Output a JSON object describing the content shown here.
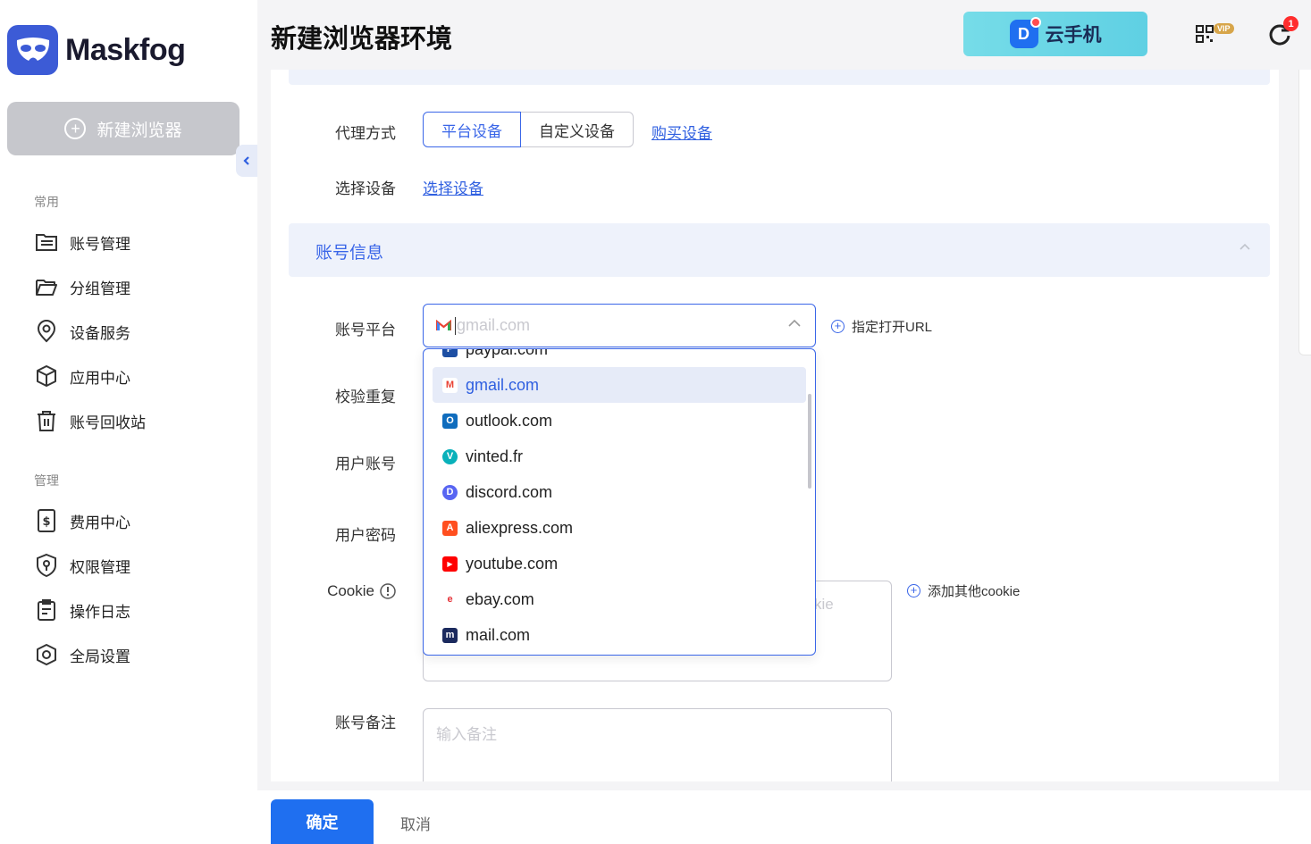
{
  "app": {
    "name": "Maskfog"
  },
  "sidebar": {
    "new_browser_label": "新建浏览器",
    "sections": [
      {
        "title": "常用",
        "items": [
          {
            "label": "账号管理",
            "icon": "account-list-icon"
          },
          {
            "label": "分组管理",
            "icon": "folder-icon"
          },
          {
            "label": "设备服务",
            "icon": "location-pin-icon"
          },
          {
            "label": "应用中心",
            "icon": "cube-icon"
          },
          {
            "label": "账号回收站",
            "icon": "trash-icon"
          }
        ]
      },
      {
        "title": "管理",
        "items": [
          {
            "label": "费用中心",
            "icon": "billing-icon"
          },
          {
            "label": "权限管理",
            "icon": "shield-key-icon"
          },
          {
            "label": "操作日志",
            "icon": "clipboard-icon"
          },
          {
            "label": "全局设置",
            "icon": "settings-hex-icon"
          }
        ]
      }
    ]
  },
  "header": {
    "title": "新建浏览器环境",
    "cloud_phone_label": "云手机",
    "vip_label": "VIP",
    "sync_badge": "1"
  },
  "form": {
    "proxy_label": "代理方式",
    "proxy_options": [
      "平台设备",
      "自定义设备"
    ],
    "proxy_selected": "平台设备",
    "buy_device_link": "购买设备",
    "select_device_label": "选择设备",
    "select_device_link": "选择设备",
    "account_section_title": "账号信息",
    "platform_label": "账号平台",
    "platform_placeholder": "gmail.com",
    "open_url_link": "指定打开URL",
    "check_duplicate_label": "校验重复",
    "username_label": "用户账号",
    "password_label": "用户密码",
    "cookie_label": "Cookie",
    "cookie_placeholder_fragment": "kie",
    "add_cookie_link": "添加其他cookie",
    "note_label": "账号备注",
    "note_placeholder": "输入备注"
  },
  "dropdown": {
    "selected": "gmail.com",
    "options": [
      {
        "label": "paypal.com",
        "color": "#1d4fa3",
        "glyph": "P"
      },
      {
        "label": "gmail.com",
        "color": "#ea4335",
        "glyph": "M"
      },
      {
        "label": "outlook.com",
        "color": "#0f6cbd",
        "glyph": "O"
      },
      {
        "label": "vinted.fr",
        "color": "#09b1ba",
        "glyph": "V"
      },
      {
        "label": "discord.com",
        "color": "#5865f2",
        "glyph": "D"
      },
      {
        "label": "aliexpress.com",
        "color": "#ff4f1f",
        "glyph": "A"
      },
      {
        "label": "youtube.com",
        "color": "#ff0000",
        "glyph": "▶"
      },
      {
        "label": "ebay.com",
        "color": "#e53238",
        "glyph": "e"
      },
      {
        "label": "mail.com",
        "color": "#1b2a5e",
        "glyph": "m"
      }
    ]
  },
  "footer": {
    "confirm_label": "确定",
    "cancel_label": "取消"
  },
  "colors": {
    "accent": "#3a66e8",
    "primary_button": "#1f6ff0",
    "sidebar_disabled_button": "#c6c7cc"
  }
}
